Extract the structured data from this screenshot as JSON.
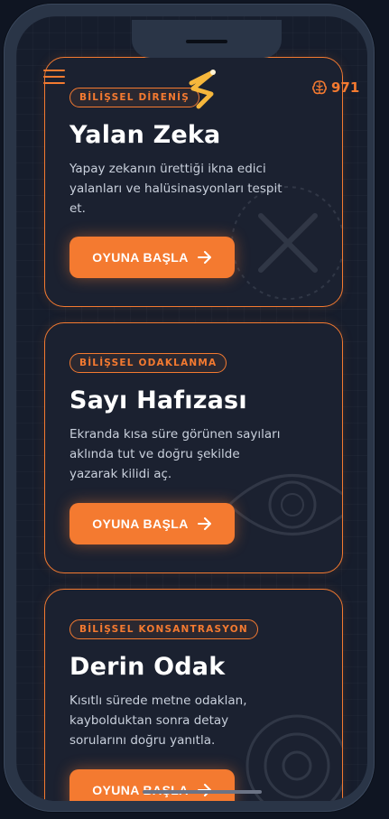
{
  "header": {
    "score": "971"
  },
  "cards": [
    {
      "tag": "BİLİŞSEL DİRENİŞ",
      "title": "Yalan Zeka",
      "desc": "Yapay zekanın ürettiği ikna edici yalanları ve halüsinasyonları tespit et.",
      "button": "OYUNA BAŞLA"
    },
    {
      "tag": "BİLİŞSEL ODAKLANMA",
      "title": "Sayı Hafızası",
      "desc": "Ekranda kısa süre görünen sayıları aklında tut ve doğru şekilde yazarak kilidi aç.",
      "button": "OYUNA BAŞLA"
    },
    {
      "tag": "BİLİŞSEL KONSANTRASYON",
      "title": "Derin Odak",
      "desc": "Kısıtlı sürede metne odaklan, kaybolduktan sonra detay sorularını doğru yanıtla.",
      "button": "OYUNA BAŞLA"
    }
  ],
  "colors": {
    "accent": "#f47a30",
    "card_bg": "#1b2130",
    "screen_bg": "#161d2c"
  },
  "icons": {
    "menu": "hamburger-icon",
    "logo": "zigzag-logo",
    "score": "brain-icon",
    "arrow": "arrow-right-icon"
  }
}
